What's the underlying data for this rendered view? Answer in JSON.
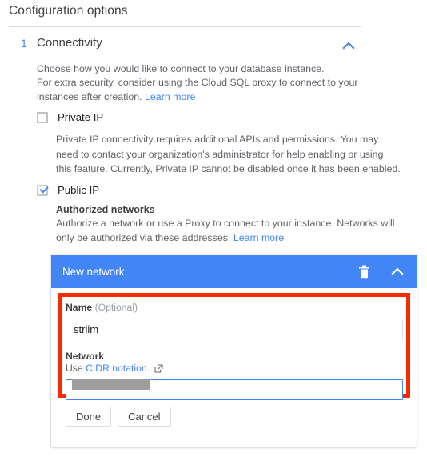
{
  "page": {
    "title": "Configuration options"
  },
  "step": {
    "number": "1",
    "title": "Connectivity",
    "collapse_icon": "chevron-up-icon",
    "description_line_1": "Choose how you would like to connect to your database instance.",
    "description_line_2_before": "For extra security, consider using the Cloud SQL proxy to connect to your instances after creation.",
    "learn_more": "Learn more"
  },
  "private_ip": {
    "label": "Private IP",
    "checked": false,
    "note": "Private IP connectivity requires additional APIs and permissions. You may need to contact your organization's administrator for help enabling or using this feature. Currently, Private IP cannot be disabled once it has been enabled."
  },
  "public_ip": {
    "label": "Public IP",
    "checked": true
  },
  "authorized_networks": {
    "title": "Authorized networks",
    "description": "Authorize a network or use a Proxy to connect to your instance. Networks will only be authorized via these addresses.",
    "learn_more": "Learn more"
  },
  "network_card": {
    "header_title": "New network",
    "delete_icon": "trash-icon",
    "collapse_icon": "chevron-up-icon",
    "name_field": {
      "label": "Name",
      "optional_suffix": "(Optional)",
      "value": "striim",
      "placeholder": ""
    },
    "network_field": {
      "label": "Network",
      "hint_prefix": "Use",
      "hint_link": "CIDR notation.",
      "external_link_icon": "open-in-new-icon",
      "value": "",
      "placeholder": "",
      "redacted": true,
      "focused": true
    },
    "buttons": {
      "done": "Done",
      "cancel": "Cancel"
    }
  },
  "colors": {
    "accent_blue": "#4285f4",
    "highlight_red": "#f72a00",
    "text_primary": "#202124",
    "text_secondary": "#5f6368",
    "divider": "#dadce0"
  }
}
